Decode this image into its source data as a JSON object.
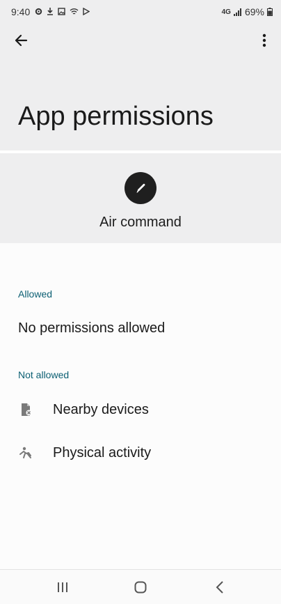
{
  "status_bar": {
    "time": "9:40",
    "network": "4G",
    "battery": "69%"
  },
  "header": {
    "back_icon": "arrow-left-icon",
    "more_icon": "more-vert-icon",
    "title": "App permissions"
  },
  "app": {
    "icon": "pen-icon",
    "name": "Air command"
  },
  "sections": {
    "allowed": {
      "label": "Allowed",
      "empty_text": "No permissions allowed"
    },
    "not_allowed": {
      "label": "Not allowed",
      "items": [
        {
          "icon": "nearby-devices-icon",
          "label": "Nearby devices"
        },
        {
          "icon": "physical-activity-icon",
          "label": "Physical activity"
        }
      ]
    }
  },
  "nav_bar": {
    "recent_icon": "recent-apps-icon",
    "home_icon": "home-icon",
    "back_icon": "back-chevron-icon"
  },
  "colors": {
    "header_bg": "#eeeeef",
    "section_label": "#0b5f73",
    "text": "#1a1a1a"
  }
}
